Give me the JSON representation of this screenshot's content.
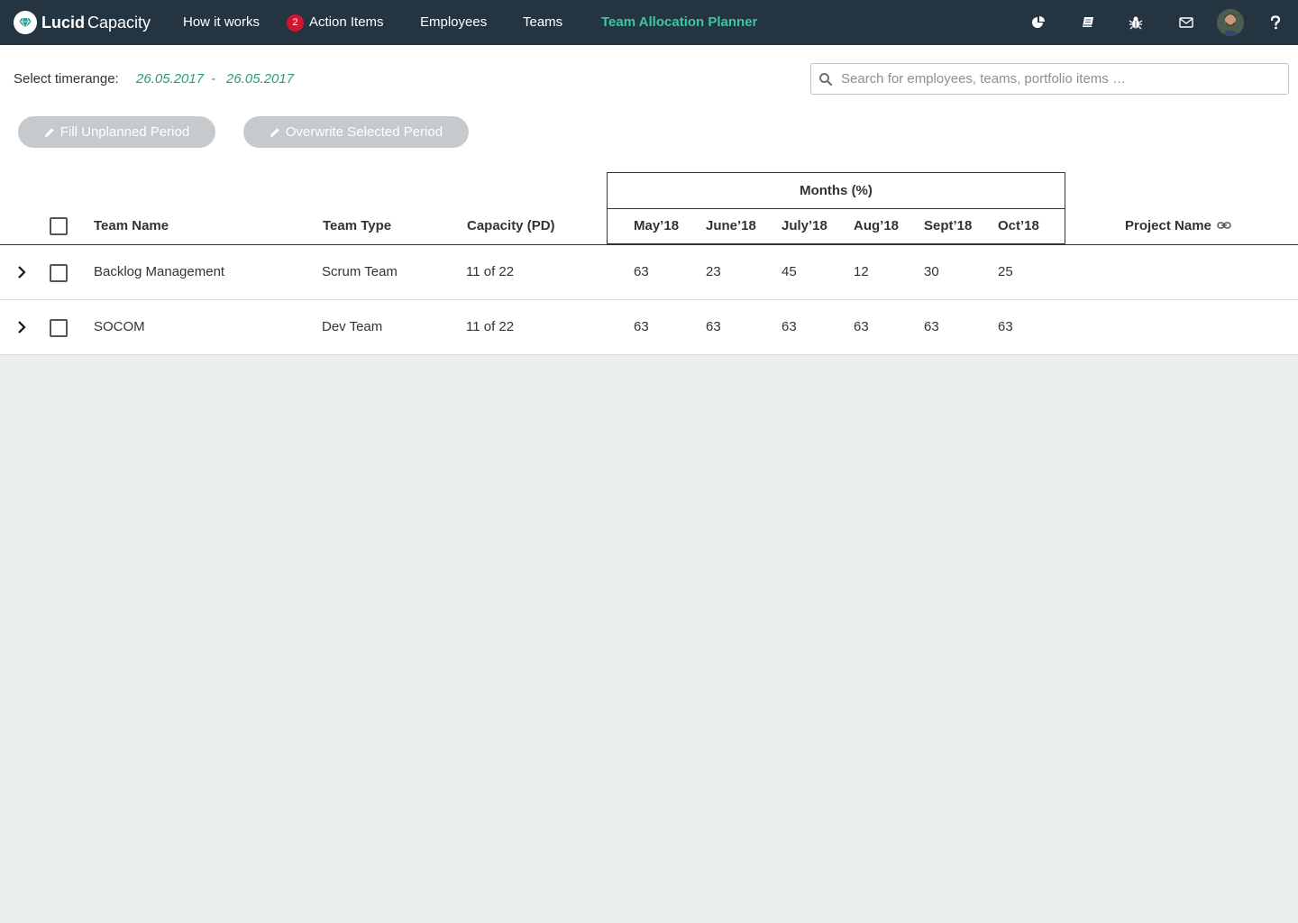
{
  "brand": {
    "name_bold": "Lucid",
    "name_light": "Capacity"
  },
  "nav": {
    "how_it_works": "How it works",
    "action_items_badge": "2",
    "action_items": "Action Items",
    "employees": "Employees",
    "teams": "Teams",
    "team_allocation_planner": "Team Allocation Planner"
  },
  "toolbar": {
    "timerange_label": "Select timerange:",
    "date_from": "26.05.2017",
    "date_separator": "-",
    "date_to": "26.05.2017",
    "search_placeholder": "Search for employees, teams, portfolio items …",
    "fill_button": "Fill Unplanned Period",
    "overwrite_button": "Overwrite Selected Period"
  },
  "table": {
    "months_group": "Months (%)",
    "columns": {
      "team_name": "Team Name",
      "team_type": "Team Type",
      "capacity": "Capacity (PD)",
      "project_name": "Project Name"
    },
    "months": [
      "May’18",
      "June’18",
      "July’18",
      "Aug’18",
      "Sept’18",
      "Oct’18"
    ],
    "rows": [
      {
        "team_name": "Backlog Management",
        "team_type": "Scrum Team",
        "capacity": "11 of 22",
        "values": [
          "63",
          "23",
          "45",
          "12",
          "30",
          "25"
        ]
      },
      {
        "team_name": "SOCOM",
        "team_type": "Dev Team",
        "capacity": "11 of 22",
        "values": [
          "63",
          "63",
          "63",
          "63",
          "63",
          "63"
        ]
      }
    ]
  },
  "colors": {
    "nav_bg": "#243441",
    "accent": "#3ec5a5",
    "badge": "#d0162e",
    "date": "#2c9a7e",
    "disabled_button": "#c6cacd"
  }
}
